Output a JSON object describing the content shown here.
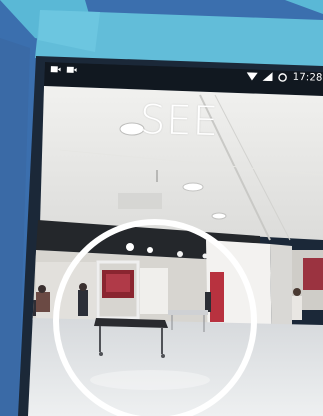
{
  "mode_label": "SEE",
  "status_bar": {
    "time": "17:28",
    "left_icons": [
      "camera-icon",
      "camera-icon"
    ],
    "right_icons": [
      "wifi-icon",
      "signal-icon",
      "sync-icon"
    ]
  },
  "colors": {
    "background": "#3b6fae",
    "accent": "#5ab8d6",
    "ring": "#ffffff"
  }
}
